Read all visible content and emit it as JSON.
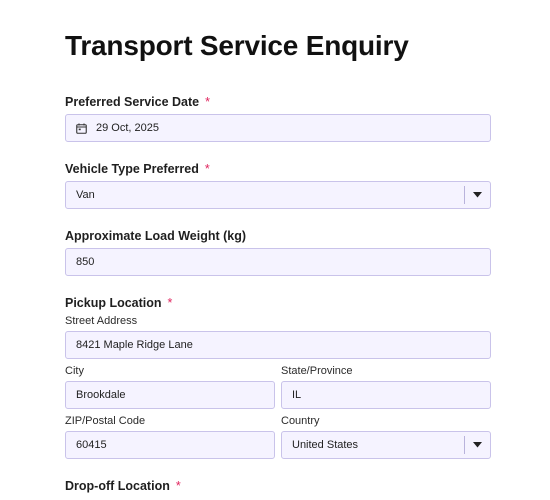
{
  "form": {
    "title": "Transport Service Enquiry",
    "required_mark": "*"
  },
  "service_date": {
    "label": "Preferred Service Date",
    "value": "29 Oct, 2025",
    "icon": "calendar-icon"
  },
  "vehicle_type": {
    "label": "Vehicle Type Preferred",
    "value": "Van",
    "icon": "chevron-down-icon"
  },
  "load_weight": {
    "label": "Approximate Load Weight (kg)",
    "value": "850"
  },
  "pickup": {
    "label": "Pickup Location",
    "street_label": "Street Address",
    "street_value": "8421 Maple Ridge Lane",
    "city_label": "City",
    "city_value": "Brookdale",
    "state_label": "State/Province",
    "state_value": "IL",
    "zip_label": "ZIP/Postal Code",
    "zip_value": "60415",
    "country_label": "Country",
    "country_value": "United States"
  },
  "dropoff": {
    "label": "Drop-off Location"
  },
  "colors": {
    "field_background": "#f5f3ff",
    "field_border": "#c9c3ea",
    "required_mark": "#e0245e",
    "text": "#1f1f1f"
  }
}
